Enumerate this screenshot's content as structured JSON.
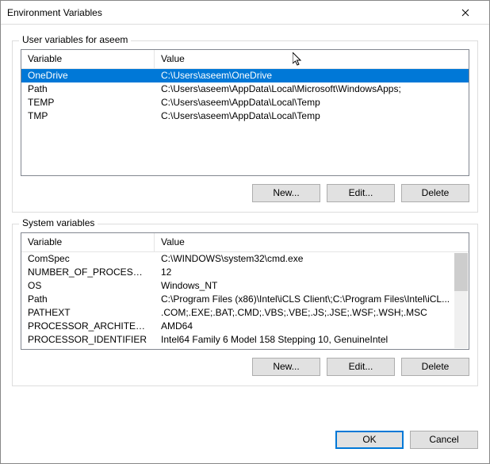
{
  "title": "Environment Variables",
  "user": {
    "legend": "User variables for aseem",
    "colName": "Variable",
    "colValue": "Value",
    "rows": [
      {
        "name": "OneDrive",
        "value": "C:\\Users\\aseem\\OneDrive",
        "selected": true
      },
      {
        "name": "Path",
        "value": "C:\\Users\\aseem\\AppData\\Local\\Microsoft\\WindowsApps;",
        "selected": false
      },
      {
        "name": "TEMP",
        "value": "C:\\Users\\aseem\\AppData\\Local\\Temp",
        "selected": false
      },
      {
        "name": "TMP",
        "value": "C:\\Users\\aseem\\AppData\\Local\\Temp",
        "selected": false
      }
    ],
    "btnNew": "New...",
    "btnEdit": "Edit...",
    "btnDelete": "Delete"
  },
  "system": {
    "legend": "System variables",
    "colName": "Variable",
    "colValue": "Value",
    "rows": [
      {
        "name": "ComSpec",
        "value": "C:\\WINDOWS\\system32\\cmd.exe"
      },
      {
        "name": "NUMBER_OF_PROCESSORS",
        "value": "12"
      },
      {
        "name": "OS",
        "value": "Windows_NT"
      },
      {
        "name": "Path",
        "value": "C:\\Program Files (x86)\\Intel\\iCLS Client\\;C:\\Program Files\\Intel\\iCL..."
      },
      {
        "name": "PATHEXT",
        "value": ".COM;.EXE;.BAT;.CMD;.VBS;.VBE;.JS;.JSE;.WSF;.WSH;.MSC"
      },
      {
        "name": "PROCESSOR_ARCHITECTURE",
        "value": "AMD64"
      },
      {
        "name": "PROCESSOR_IDENTIFIER",
        "value": "Intel64 Family 6 Model 158 Stepping 10, GenuineIntel"
      }
    ],
    "btnNew": "New...",
    "btnEdit": "Edit...",
    "btnDelete": "Delete"
  },
  "footer": {
    "ok": "OK",
    "cancel": "Cancel"
  }
}
